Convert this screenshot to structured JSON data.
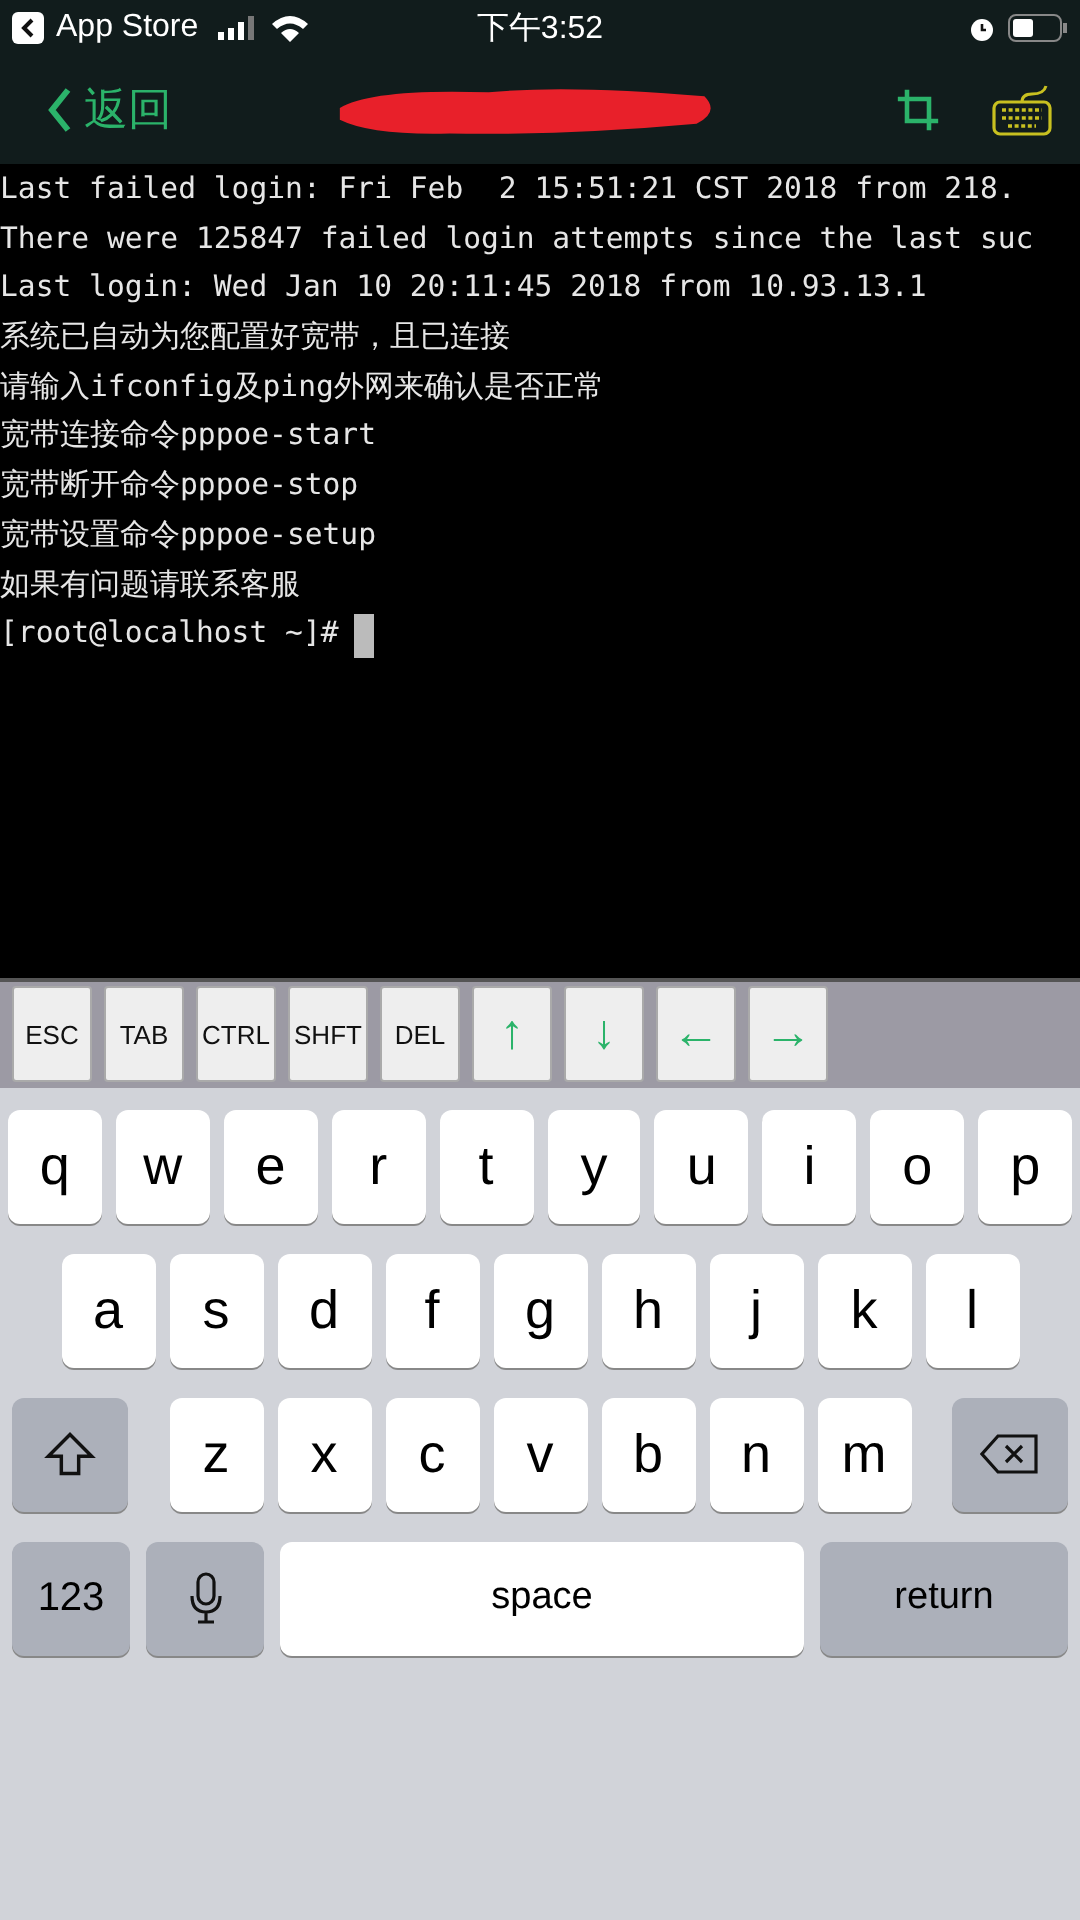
{
  "status_bar": {
    "back_app": "App Store",
    "time": "下午3:52"
  },
  "nav": {
    "back": "返回"
  },
  "terminal": {
    "lines": [
      "Last failed login: Fri Feb  2 15:51:21 CST 2018 from 218.",
      "There were 125847 failed login attempts since the last suc",
      "Last login: Wed Jan 10 20:11:45 2018 from 10.93.13.1",
      "系统已自动为您配置好宽带，且已连接",
      "请输入ifconfig及ping外网来确认是否正常",
      "宽带连接命令pppoe-start",
      "宽带断开命令pppoe-stop",
      "宽带设置命令pppoe-setup",
      "如果有问题请联系客服"
    ],
    "prompt": "[root@localhost ~]#"
  },
  "extra_keys": [
    {
      "label": "ESC",
      "kind": "text"
    },
    {
      "label": "TAB",
      "kind": "text"
    },
    {
      "label": "CTRL",
      "kind": "text"
    },
    {
      "label": "SHFT",
      "kind": "text"
    },
    {
      "label": "DEL",
      "kind": "text"
    },
    {
      "label": "↑",
      "kind": "arrow"
    },
    {
      "label": "↓",
      "kind": "arrow"
    },
    {
      "label": "←",
      "kind": "arrow"
    },
    {
      "label": "→",
      "kind": "arrow"
    }
  ],
  "keyboard": {
    "rows": [
      [
        "q",
        "w",
        "e",
        "r",
        "t",
        "y",
        "u",
        "i",
        "o",
        "p"
      ],
      [
        "a",
        "s",
        "d",
        "f",
        "g",
        "h",
        "j",
        "k",
        "l"
      ],
      [
        "z",
        "x",
        "c",
        "v",
        "b",
        "n",
        "m"
      ]
    ],
    "numbers": "123",
    "space": "space",
    "return": "return"
  }
}
